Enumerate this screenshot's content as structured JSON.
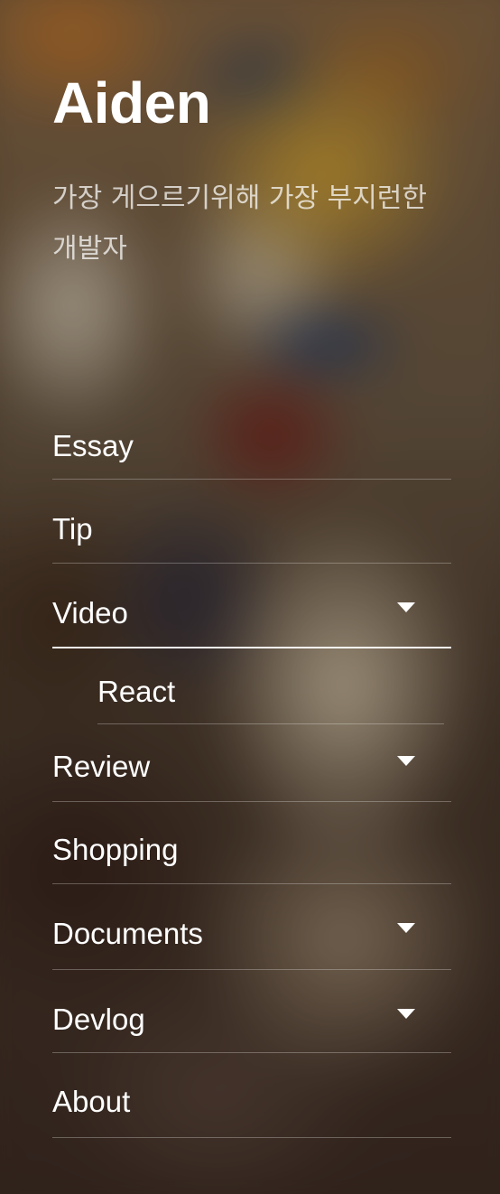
{
  "site": {
    "title": "Aiden",
    "description": "가장 게으르기위해 가장 부지런한 개발자"
  },
  "menu": {
    "items": [
      {
        "label": "Essay",
        "has_submenu": false
      },
      {
        "label": "Tip",
        "has_submenu": false
      },
      {
        "label": "Video",
        "has_submenu": true,
        "expanded": true
      },
      {
        "label": "React",
        "is_subitem": true
      },
      {
        "label": "Review",
        "has_submenu": true
      },
      {
        "label": "Shopping",
        "has_submenu": false
      },
      {
        "label": "Documents",
        "has_submenu": true
      },
      {
        "label": "Devlog",
        "has_submenu": true
      },
      {
        "label": "About",
        "has_submenu": false
      }
    ]
  },
  "icons": {
    "expand": "chevron-down-icon"
  },
  "colors": {
    "text": "#ffffff",
    "description_text": "#d8d2cc",
    "divider": "rgba(255,255,255,0.28)",
    "active_divider": "#ffffff"
  }
}
